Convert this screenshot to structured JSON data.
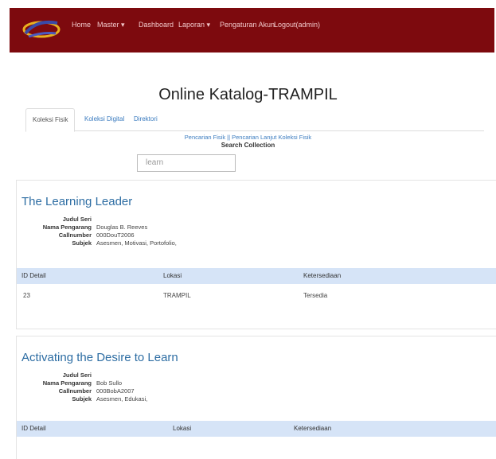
{
  "navbar": {
    "items": [
      {
        "label": "Home"
      },
      {
        "label": "Master"
      },
      {
        "label": "Dashboard"
      },
      {
        "label": "Laporan"
      },
      {
        "label": "Pengaturan Akun"
      },
      {
        "label": "Logout(admin)"
      }
    ],
    "caret": "▾",
    "logo_icon": "logo-icon"
  },
  "page_title": "Online Katalog-TRAMPIL",
  "tabs": [
    {
      "label": "Koleksi Fisik",
      "active": true
    },
    {
      "label": "Koleksi Digital",
      "active": false
    },
    {
      "label": "Direktori",
      "active": false
    }
  ],
  "search": {
    "links": "Pencarian Fisik || Pencarian Lanjut Koleksi Fisik",
    "heading": "Search Collection",
    "value": "learn"
  },
  "books": [
    {
      "title": "The Learning Leader",
      "fields": [
        {
          "label": "Judul Seri",
          "value": ""
        },
        {
          "label": "Nama Pengarang",
          "value": "Douglas B. Reeves"
        },
        {
          "label": "Callnumber",
          "value": "000DouT2006"
        },
        {
          "label": "Subjek",
          "value": "Asesmen, Motivasi, Portofolio,"
        }
      ],
      "table": {
        "headers": [
          "ID Detail",
          "Lokasi",
          "Ketersediaan"
        ],
        "rows": [
          [
            "23",
            "TRAMPIL",
            "Tersedia"
          ]
        ]
      }
    },
    {
      "title": "Activating the Desire to Learn",
      "fields": [
        {
          "label": "Judul Seri",
          "value": ""
        },
        {
          "label": "Nama Pengarang",
          "value": "Bob Sullo"
        },
        {
          "label": "Callnumber",
          "value": "000BobA2007"
        },
        {
          "label": "Subjek",
          "value": "Asesmen, Edukasi,"
        }
      ],
      "table": {
        "headers": [
          "ID Detail",
          "Lokasi",
          "Ketersediaan"
        ],
        "rows": []
      }
    }
  ],
  "colors": {
    "navbar": "#7d0a0e",
    "link": "#3a7bbf",
    "table_header": "#d6e4f7",
    "title": "#2d6da3"
  }
}
